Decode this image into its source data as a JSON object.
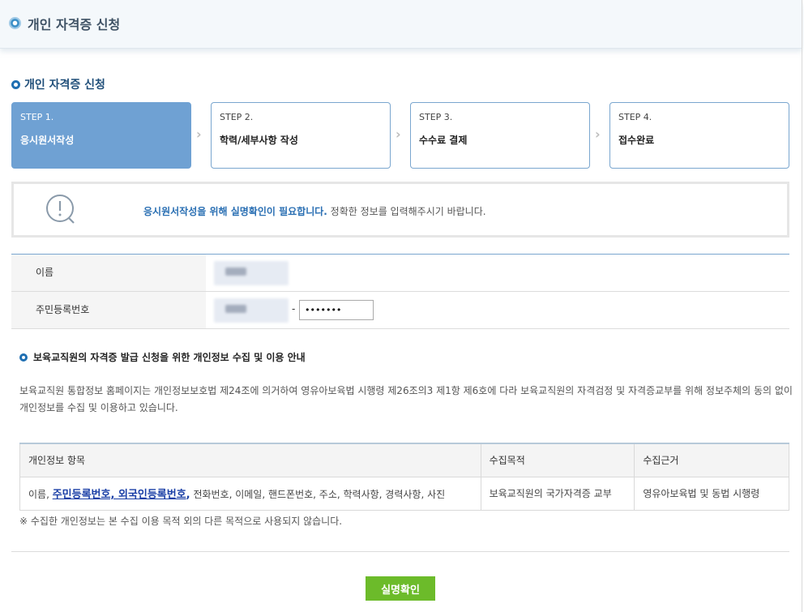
{
  "header": {
    "title": "개인 자격증 신청"
  },
  "section": {
    "title": "개인 자격증 신청"
  },
  "steps": [
    {
      "no": "STEP 1.",
      "name": "응시원서작성",
      "active": true
    },
    {
      "no": "STEP 2.",
      "name": "학력/세부사항 작성",
      "active": false
    },
    {
      "no": "STEP 3.",
      "name": "수수료 결제",
      "active": false
    },
    {
      "no": "STEP 4.",
      "name": "접수완료",
      "active": false
    }
  ],
  "notice": {
    "highlight": "응시원서작성을 위해 실명확인이 필요합니다.",
    "rest": " 정확한 정보를 입력해주시기 바랍니다."
  },
  "form": {
    "name_label": "이름",
    "rrn_label": "주민등록번호",
    "rrn_separator": "-",
    "rrn_back_value": "•••••••"
  },
  "privacy": {
    "title": "보육교직원의 자격증 발급 신청을 위한 개인정보 수집 및 이용 안내",
    "description": "보육교직원 통합정보 홈페이지는 개인정보보호법 제24조에 의거하여 영유아보육법 시행령 제26조의3 제1항 제6호에 다라 보육교직원의 자격검정 및 자격증교부를 위해 정보주체의 동의 없이 개인정보를 수집 및 이용하고 있습니다.",
    "table": {
      "headers": [
        "개인정보 항목",
        "수집목적",
        "수집근거"
      ],
      "row": {
        "items_prefix": "이름, ",
        "items_link": "주민등록번호, 외국인등록번호",
        "items_link_suffix": ",",
        "items_suffix": " 전화번호, 이메일, 핸드폰번호, 주소, 학력사항, 경력사항, 사진",
        "purpose": "보육교직원의 국가자격증 교부",
        "basis": "영유아보육법 및 동법 시행령"
      }
    },
    "note": "※ 수집한 개인정보는 본 수집 이용 목적 외의 다른 목적으로 사용되지 않습니다."
  },
  "actions": {
    "confirm_label": "실명확인"
  },
  "colors": {
    "accent": "#6fa1d3",
    "button": "#6cbb2a",
    "title": "#1f4e79"
  },
  "icons": {
    "notice": "exclamation-search-icon",
    "step_arrow": "chevron-right-icon",
    "bullet": "circle-bullet-icon"
  }
}
